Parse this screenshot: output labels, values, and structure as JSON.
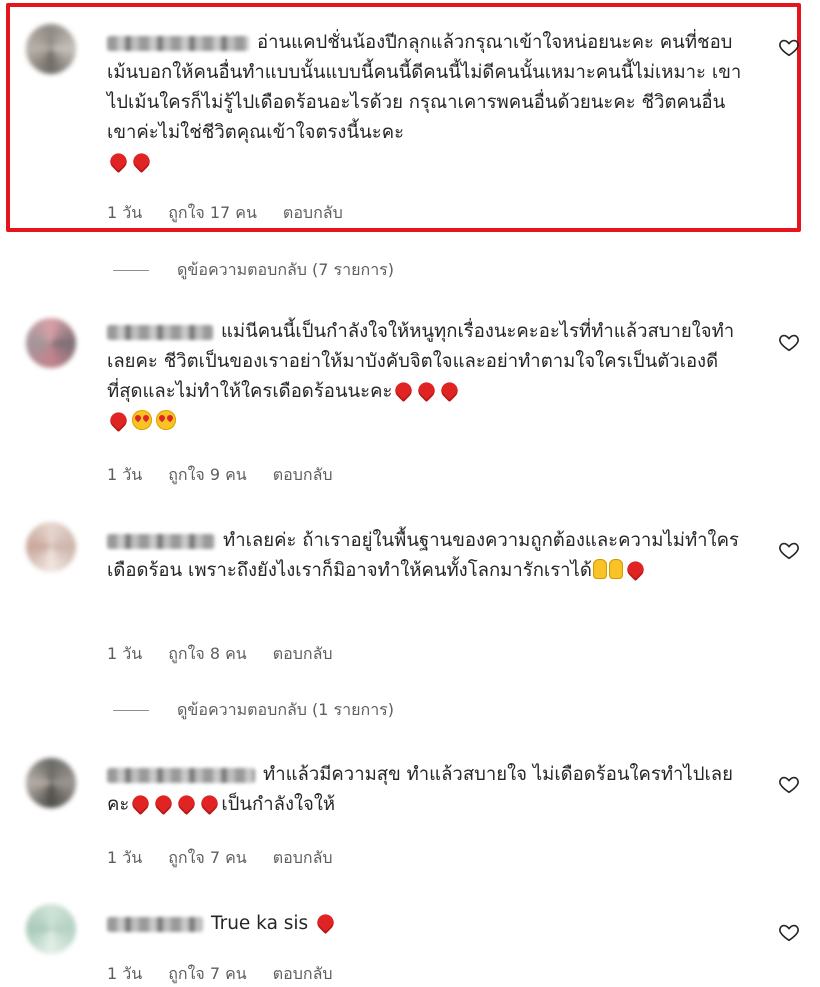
{
  "comments": [
    {
      "text": "อ่านแคปชั่นน้องปีกลุกแล้วกรุณาเข้าใจหน่อยนะคะ คนที่ชอบเม้นบอกให้คนอื่นทำแบบนั้นแบบนี้คนนี้ดีคนนี้ไม่ดีคนนั้นเหมาะคนนี้ไม่เหมาะ เขาไปเม้นใครก็ไม่รู้ไปเดือดร้อนอะไรด้วย กรุณาเคารพคนอื่นด้วยนะคะ ชีวิตคนอื่นเขาค่ะไม่ใช่ชีวิตคุณเข้าใจตรงนี้นะคะ",
      "time": "1 วัน",
      "likes": "ถูกใจ 17 คน",
      "reply": "ตอบกลับ",
      "view_replies": "ดูข้อความตอบกลับ (7 รายการ)",
      "emojis": [
        "red-heart",
        "red-heart"
      ]
    },
    {
      "text": "แม่นีคนนี้เป็นกำลังใจให้หนูทุกเรื่องนะคะอะไรที่ทำแล้วสบายใจทำเลยคะ ชีวิตเป็นของเราอย่าให้มาบังคับจิตใจและอย่าทำตามใจใครเป็นตัวเองดีที่สุดและไม่ทำให้ใครเดือดร้อนนะคะ",
      "time": "1 วัน",
      "likes": "ถูกใจ 9 คน",
      "reply": "ตอบกลับ",
      "emojis": [
        "red-heart",
        "red-heart",
        "red-heart",
        "red-heart",
        "heart-eyes",
        "heart-eyes"
      ]
    },
    {
      "text": "ทำเลยค่ะ ถ้าเราอยู่ในพื้นฐานของความถูกต้องและความไม่ทำใครเดือดร้อน เพราะถึงยังไงเราก็มิอาจทำให้คนทั้งโลกมารักเราได้",
      "time": "1 วัน",
      "likes": "ถูกใจ 8 คน",
      "reply": "ตอบกลับ",
      "view_replies": "ดูข้อความตอบกลับ (1 รายการ)",
      "emojis": [
        "victory-hand",
        "victory-hand",
        "red-heart"
      ]
    },
    {
      "text": "ทำแล้วมีความสุข ทำแล้วสบายใจ ไม่เดือดร้อนใครทำไปเลยคะ",
      "text_after": "เป็นกำลังใจให้",
      "time": "1 วัน",
      "likes": "ถูกใจ 7 คน",
      "reply": "ตอบกลับ",
      "emojis": [
        "red-heart",
        "red-heart",
        "red-heart",
        "red-heart"
      ]
    },
    {
      "text": "True ka sis",
      "time": "1 วัน",
      "likes": "ถูกใจ 7 คน",
      "reply": "ตอบกลับ",
      "emojis": [
        "red-heart"
      ]
    }
  ],
  "colors": {
    "highlight": "#e4151d",
    "heart": "#e02424",
    "meta": "#5e5e5e"
  }
}
